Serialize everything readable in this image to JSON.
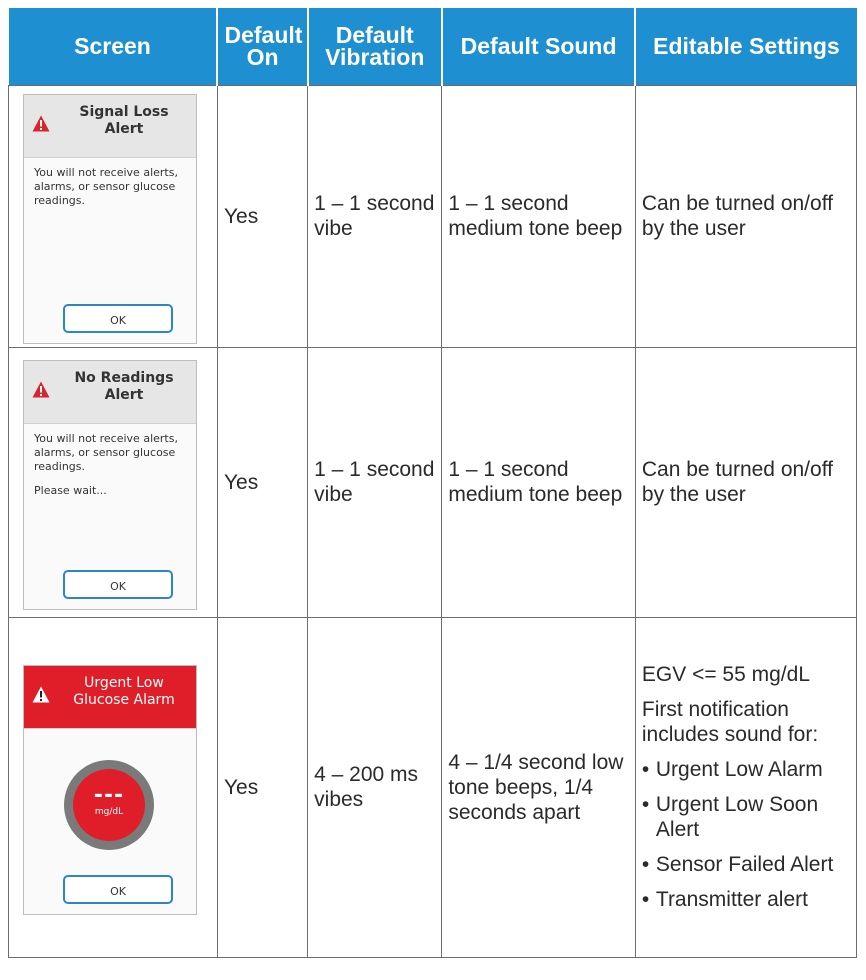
{
  "table": {
    "headers": [
      "Screen",
      "Default On",
      "Default Vibration",
      "Default Sound",
      "Editable Settings"
    ],
    "header_color": "#1e8fd0",
    "rows": [
      {
        "screen": {
          "title": "Signal Loss Alert",
          "message": "You will not receive alerts, alarms, or sensor glucose readings.",
          "ok_label": "OK",
          "icon": "warning-triangle-icon"
        },
        "default_on": "Yes",
        "vibration": "1 – 1 second vibe",
        "sound": "1 – 1 second medium tone beep",
        "editable": "Can be turned on/off by the user"
      },
      {
        "screen": {
          "title": "No Readings Alert",
          "message": "You will not receive alerts, alarms, or sensor glucose readings.",
          "wait": "Please wait...",
          "ok_label": "OK",
          "icon": "warning-triangle-icon"
        },
        "default_on": "Yes",
        "vibration": "1 – 1 second vibe",
        "sound": "1 – 1 second medium tone beep",
        "editable": "Can be turned on/off by the user"
      },
      {
        "screen": {
          "title": "Urgent Low Glucose Alarm",
          "reading": "---",
          "unit": "mg/dL",
          "ok_label": "OK",
          "icon": "warning-triangle-icon",
          "header_color": "#e01e2a"
        },
        "default_on": "Yes",
        "vibration": "4 – 200 ms vibes",
        "sound": "4 – 1/4 second low tone beeps, 1/4 seconds apart",
        "editable_threshold": "EGV <= 55 mg/dL",
        "editable_intro": "First notification includes sound for:",
        "editable_items": [
          "Urgent Low Alarm",
          "Urgent Low Soon Alert",
          "Sensor Failed Alert",
          "Transmitter alert"
        ]
      }
    ]
  }
}
